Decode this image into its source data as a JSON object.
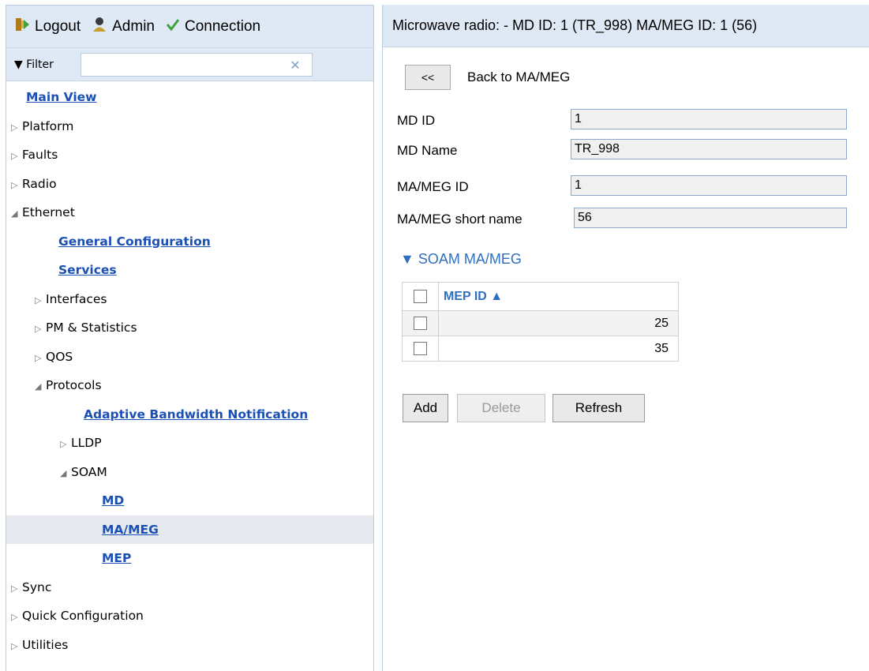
{
  "topbar": {
    "logout_label": "Logout",
    "admin_label": "Admin",
    "connection_label": "Connection",
    "logout_icon": "logout-icon",
    "admin_icon": "admin-user-icon",
    "connection_icon": "checkmark-icon"
  },
  "filter": {
    "label": "Filter",
    "value": ""
  },
  "tree": [
    {
      "label": "Main View",
      "level": 0,
      "link": true
    },
    {
      "label": "Platform",
      "level": 0,
      "expand": "closed"
    },
    {
      "label": "Faults",
      "level": 0,
      "expand": "closed"
    },
    {
      "label": "Radio",
      "level": 0,
      "expand": "closed"
    },
    {
      "label": "Ethernet",
      "level": 0,
      "expand": "open"
    },
    {
      "label": "General Configuration",
      "level": 1,
      "link": true
    },
    {
      "label": "Services",
      "level": 1,
      "link": true
    },
    {
      "label": "Interfaces",
      "level": 1,
      "expand": "closed"
    },
    {
      "label": "PM & Statistics",
      "level": 1,
      "expand": "closed"
    },
    {
      "label": "QOS",
      "level": 1,
      "expand": "closed"
    },
    {
      "label": "Protocols",
      "level": 1,
      "expand": "open"
    },
    {
      "label": "Adaptive Bandwidth Notification",
      "level": 2,
      "link": true
    },
    {
      "label": "LLDP",
      "level": 2,
      "expand": "closed"
    },
    {
      "label": "SOAM",
      "level": 2,
      "expand": "open"
    },
    {
      "label": "MD",
      "level": 3,
      "link": true
    },
    {
      "label": "MA/MEG",
      "level": 3,
      "link": true,
      "selected": true
    },
    {
      "label": "MEP",
      "level": 3,
      "link": true
    },
    {
      "label": "Sync",
      "level": 0,
      "expand": "closed"
    },
    {
      "label": "Quick Configuration",
      "level": 0,
      "expand": "closed"
    },
    {
      "label": "Utilities",
      "level": 0,
      "expand": "closed"
    }
  ],
  "header": {
    "title": "Microwave radio: - MD ID: 1 (TR_998) MA/MEG ID: 1 (56)"
  },
  "back": {
    "button_label": "<<",
    "label": "Back to MA/MEG"
  },
  "fields": {
    "md_id_label": "MD ID",
    "md_id_value": "1",
    "md_name_label": "MD Name",
    "md_name_value": "TR_998",
    "ma_meg_id_label": "MA/MEG ID",
    "ma_meg_id_value": "1",
    "ma_meg_short_name_label": "MA/MEG short name",
    "ma_meg_short_name_value": "56"
  },
  "soam": {
    "section_label": "▼ SOAM MA/MEG",
    "column_header": "MEP ID ▲",
    "rows": [
      "25",
      "35"
    ]
  },
  "actions": {
    "add_label": "Add",
    "delete_label": "Delete",
    "refresh_label": "Refresh"
  },
  "colors": {
    "panel_header_bg": "#dfe9f5",
    "link": "#1a4fb5",
    "accent_blue": "#2f6fbe",
    "selected_row": "#e6eaef"
  }
}
